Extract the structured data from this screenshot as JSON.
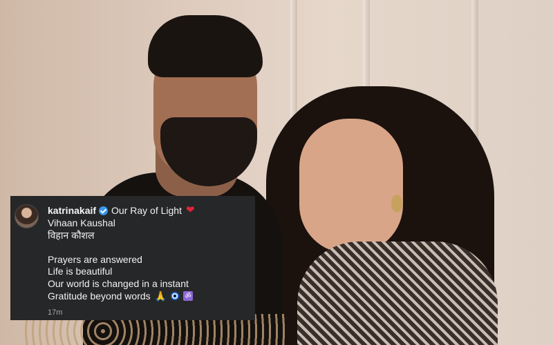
{
  "photo": {
    "subject": "couple portrait background"
  },
  "comment": {
    "username": "katrinakaif",
    "verified": true,
    "heading": "Our Ray of Light",
    "heart": "❤",
    "lines": [
      "Vihaan Kaushal",
      "विहान कौशल",
      "",
      "Prayers are answered",
      "Life is beautiful",
      "Our world is changed in a instant",
      "Gratitude beyond words"
    ],
    "emoji": {
      "pray": "🙏",
      "evil_eye": "",
      "om": "ॐ"
    },
    "timestamp": "17m"
  },
  "icons": {
    "verified": "verified-badge-icon",
    "heart": "red-heart-icon",
    "pray": "praying-hands-icon",
    "evil_eye": "evil-eye-icon",
    "om": "om-icon"
  },
  "colors": {
    "card_background": "#262729",
    "text": "#f2f2f2",
    "verified": "#3897f0",
    "heart": "#e0243a",
    "timestamp": "#a8a8a8"
  }
}
